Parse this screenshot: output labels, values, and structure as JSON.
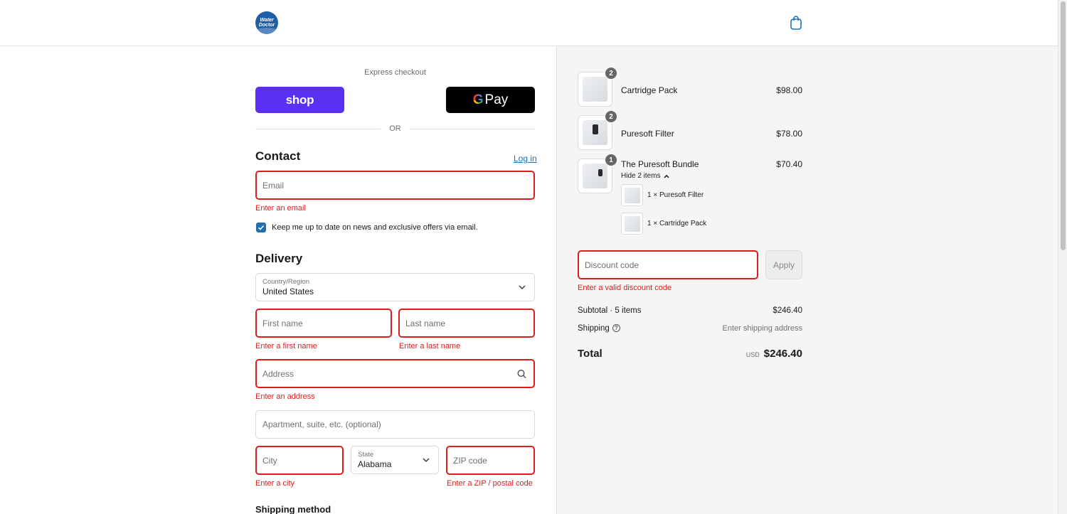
{
  "header": {
    "logo_text_1": "Water",
    "logo_text_2": "Doctor",
    "cart_icon": "shopping-bag-icon"
  },
  "express": {
    "label": "Express checkout",
    "shop_pay_label": "shop",
    "gpay_g": "G",
    "gpay_label": "Pay",
    "or_label": "OR"
  },
  "contact": {
    "title": "Contact",
    "login_link": "Log in",
    "email_placeholder": "Email",
    "email_error": "Enter an email",
    "newsletter_label": "Keep me up to date on news and exclusive offers via email.",
    "newsletter_checked": true
  },
  "delivery": {
    "title": "Delivery",
    "country_label": "Country/Region",
    "country_value": "United States",
    "first_name_placeholder": "First name",
    "first_name_error": "Enter a first name",
    "last_name_placeholder": "Last name",
    "last_name_error": "Enter a last name",
    "address_placeholder": "Address",
    "address_error": "Enter an address",
    "apartment_placeholder": "Apartment, suite, etc. (optional)",
    "city_placeholder": "City",
    "city_error": "Enter a city",
    "state_label": "State",
    "state_value": "Alabama",
    "zip_placeholder": "ZIP code",
    "zip_error": "Enter a ZIP / postal code"
  },
  "shipping_method_title": "Shipping method",
  "cart": {
    "items": [
      {
        "name": "Cartridge Pack",
        "price": "$98.00",
        "qty": "2"
      },
      {
        "name": "Puresoft Filter",
        "price": "$78.00",
        "qty": "2"
      },
      {
        "name": "The Puresoft Bundle",
        "price": "$70.40",
        "qty": "1"
      }
    ],
    "hide_items_label": "Hide 2 items",
    "bundle_contents": [
      "1 × Puresoft Filter",
      "1 × Cartridge Pack"
    ]
  },
  "discount": {
    "placeholder": "Discount code",
    "apply_label": "Apply",
    "error": "Enter a valid discount code"
  },
  "summary": {
    "subtotal_label": "Subtotal · 5 items",
    "subtotal_value": "$246.40",
    "shipping_label": "Shipping",
    "shipping_value": "Enter shipping address",
    "total_label": "Total",
    "currency": "USD",
    "total_value": "$246.40"
  },
  "colors": {
    "accent": "#1f6fb2",
    "error": "#dd1d1d",
    "shop_pay": "#5a31f4",
    "gpay": "#000000",
    "sidebar_bg": "#f5f5f5"
  }
}
